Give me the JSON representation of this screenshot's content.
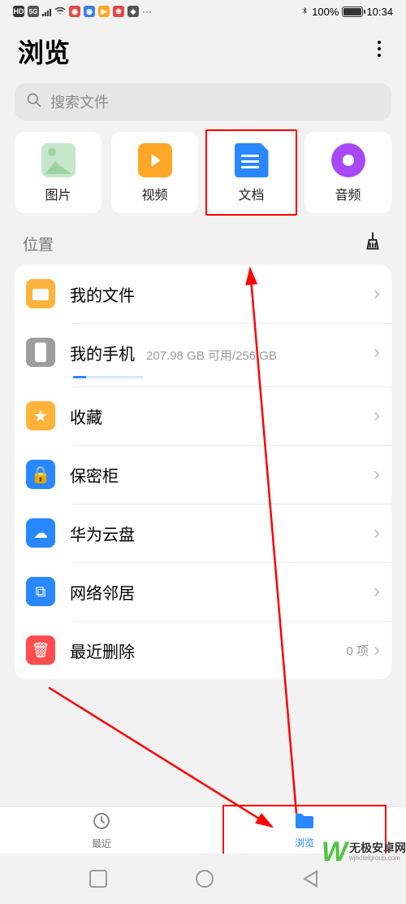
{
  "status": {
    "hd": "HD",
    "net": "5G",
    "bluetooth": "✱",
    "battery_pct": "100%",
    "time": "10:34"
  },
  "header": {
    "title": "浏览"
  },
  "search": {
    "placeholder": "搜索文件"
  },
  "categories": [
    {
      "label": "图片"
    },
    {
      "label": "视频"
    },
    {
      "label": "文档"
    },
    {
      "label": "音频"
    }
  ],
  "section": {
    "label": "位置"
  },
  "locations": {
    "my_files": "我的文件",
    "my_phone": "我的手机",
    "my_phone_storage": "207.98 GB 可用/256 GB",
    "storage_used_pct": 19,
    "favorites": "收藏",
    "safe": "保密柜",
    "cloud": "华为云盘",
    "network": "网络邻居",
    "recent_deleted": "最近删除",
    "recent_deleted_count": "0 项"
  },
  "tabs": {
    "recent": "最近",
    "browse": "浏览"
  },
  "watermark": {
    "cn": "无极安卓网",
    "en": "wjhotelgroup.com"
  }
}
